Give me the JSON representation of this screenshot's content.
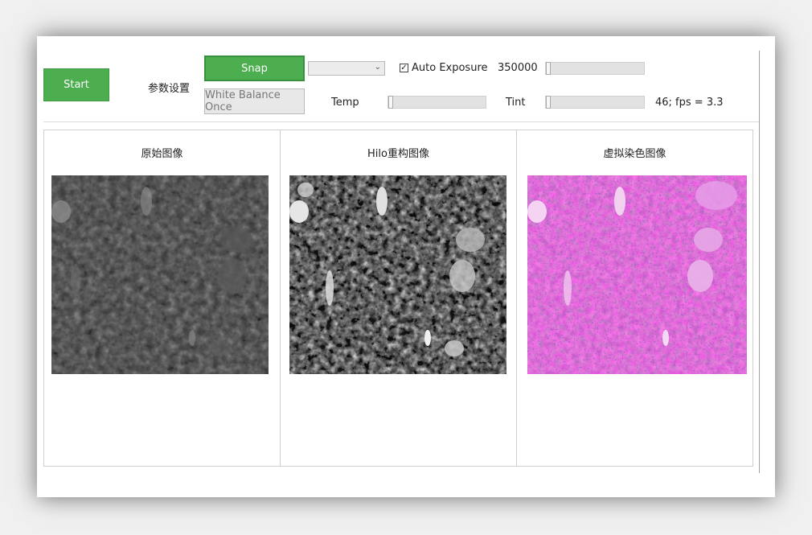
{
  "toolbar": {
    "start_label": "Start",
    "params_label": "参数设置",
    "snap_label": "Snap",
    "white_balance_label": "White Balance Once",
    "auto_exposure_label": "Auto Exposure",
    "auto_exposure_checked": true,
    "exposure_value": "350000",
    "temp_label": "Temp",
    "tint_label": "Tint",
    "fps_status": "46; fps = 3.3",
    "exposure_slider_fraction": 0.0,
    "temp_slider_fraction": 0.0,
    "tint_slider_fraction": 0.0
  },
  "panels": [
    {
      "title": "原始图像"
    },
    {
      "title": "Hilo重构图像"
    },
    {
      "title": "虚拟染色图像"
    }
  ],
  "colors": {
    "accent_green": "#4cae4f",
    "stain_pink": "#d24cd8",
    "stain_purple": "#6a2b9a"
  }
}
